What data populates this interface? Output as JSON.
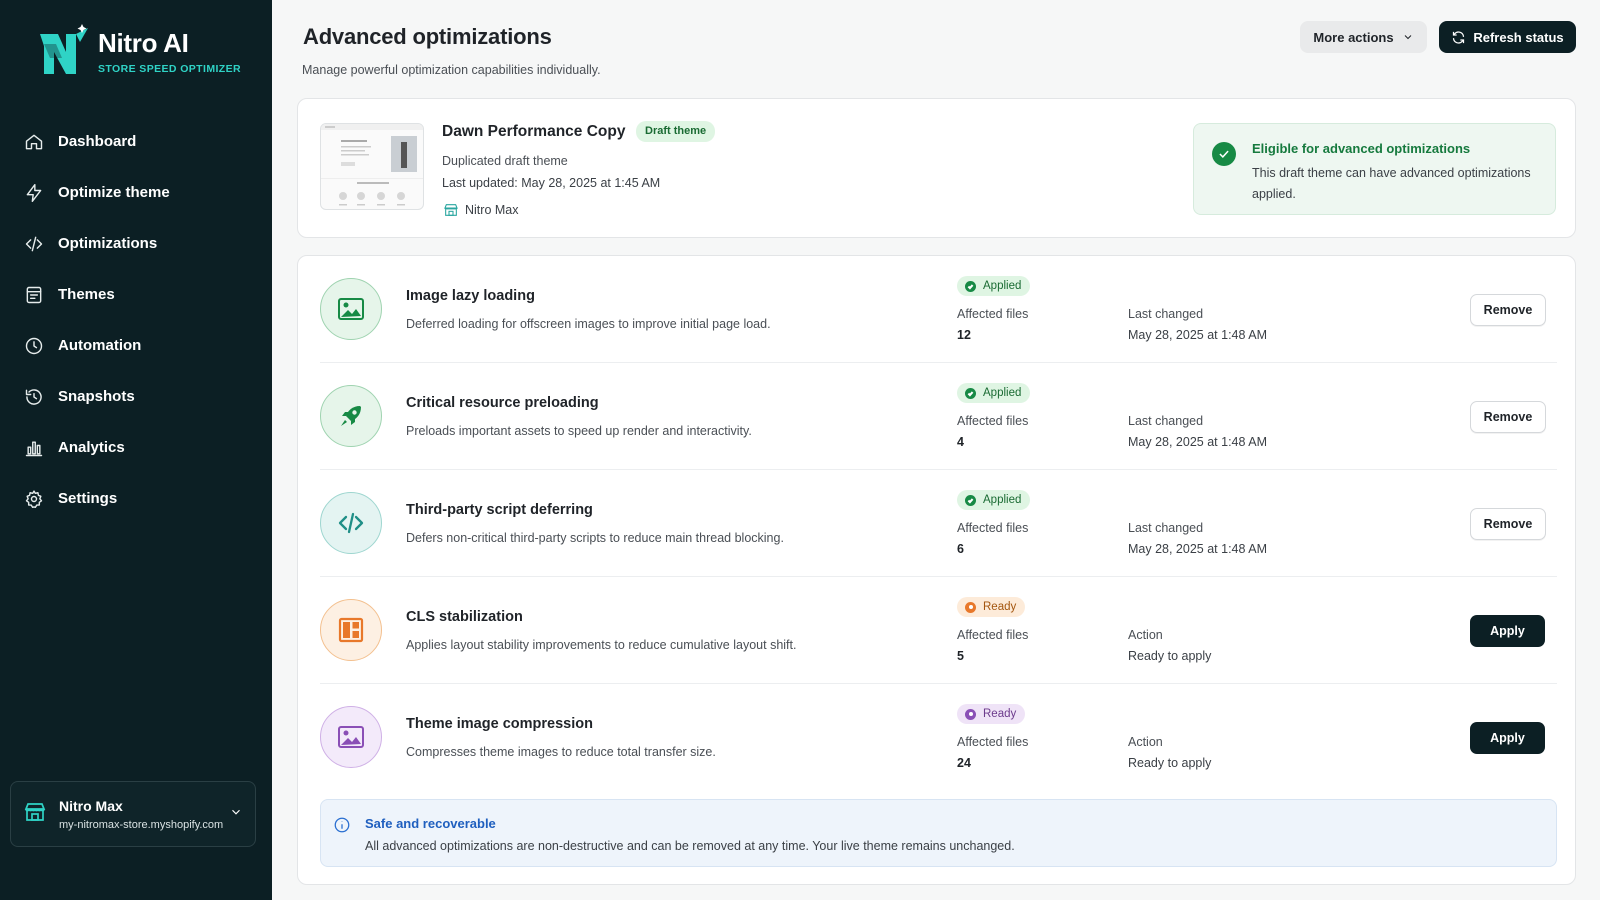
{
  "app": {
    "name": "Nitro AI",
    "tagline": "STORE SPEED OPTIMIZER"
  },
  "sidebar": {
    "items": [
      {
        "label": "Dashboard",
        "icon": "home-icon"
      },
      {
        "label": "Optimize theme",
        "icon": "bolt-icon"
      },
      {
        "label": "Optimizations",
        "icon": "code-icon"
      },
      {
        "label": "Themes",
        "icon": "theme-icon"
      },
      {
        "label": "Automation",
        "icon": "clock-icon"
      },
      {
        "label": "Snapshots",
        "icon": "history-icon"
      },
      {
        "label": "Analytics",
        "icon": "bar-chart-icon"
      },
      {
        "label": "Settings",
        "icon": "gear-icon"
      }
    ],
    "store": {
      "name": "Nitro Max",
      "domain": "my-nitromax-store.myshopify.com"
    }
  },
  "header": {
    "title": "Advanced optimizations",
    "subtitle": "Manage powerful optimization capabilities individually.",
    "more_actions_label": "More actions",
    "refresh_label": "Refresh status"
  },
  "theme": {
    "name": "Dawn Performance Copy",
    "badge": "Draft theme",
    "description": "Duplicated draft theme",
    "last_updated": "Last updated: May 28, 2025 at 1:45 AM",
    "store": "Nitro Max",
    "eligibility": {
      "title": "Eligible for advanced optimizations",
      "description": "This draft theme can have advanced optimizations applied."
    }
  },
  "optimizations": [
    {
      "title": "Image lazy loading",
      "description": "Deferred loading for offscreen images to improve initial page load.",
      "icon": "image-icon",
      "accent": "#178a45",
      "status": "Applied",
      "affected_label": "Affected files",
      "affected": "12",
      "meta_label": "Last changed",
      "meta_value": "May 28, 2025 at 1:48 AM",
      "action": "Remove"
    },
    {
      "title": "Critical resource preloading",
      "description": "Preloads important assets to speed up render and interactivity.",
      "icon": "rocket-icon",
      "accent": "#178a45",
      "status": "Applied",
      "affected_label": "Affected files",
      "affected": "4",
      "meta_label": "Last changed",
      "meta_value": "May 28, 2025 at 1:48 AM",
      "action": "Remove"
    },
    {
      "title": "Third-party script deferring",
      "description": "Defers non-critical third-party scripts to reduce main thread blocking.",
      "icon": "code-icon",
      "accent": "#1f8f87",
      "status": "Applied",
      "affected_label": "Affected files",
      "affected": "6",
      "meta_label": "Last changed",
      "meta_value": "May 28, 2025 at 1:48 AM",
      "action": "Remove"
    },
    {
      "title": "CLS stabilization",
      "description": "Applies layout stability improvements to reduce cumulative layout shift.",
      "icon": "layout-icon",
      "accent": "#e8782a",
      "status": "Ready",
      "affected_label": "Affected files",
      "affected": "5",
      "meta_label": "Action",
      "meta_value": "Ready to apply",
      "action": "Apply"
    },
    {
      "title": "Theme image compression",
      "description": "Compresses theme images to reduce total transfer size.",
      "icon": "image-icon",
      "accent": "#8a4fb6",
      "status": "Ready",
      "affected_label": "Affected files",
      "affected": "24",
      "meta_label": "Action",
      "meta_value": "Ready to apply",
      "action": "Apply"
    }
  ],
  "notice": {
    "title": "Safe and recoverable",
    "description": "All advanced optimizations are non-destructive and can be removed at any time. Your live theme remains unchanged."
  },
  "colors": {
    "sidebar_bg": "#0c1f24",
    "brand_accent": "#2fd3c6",
    "success": "#178a45",
    "warning": "#e8782a",
    "purple": "#8a4fb6",
    "info": "#2a6fd1"
  }
}
